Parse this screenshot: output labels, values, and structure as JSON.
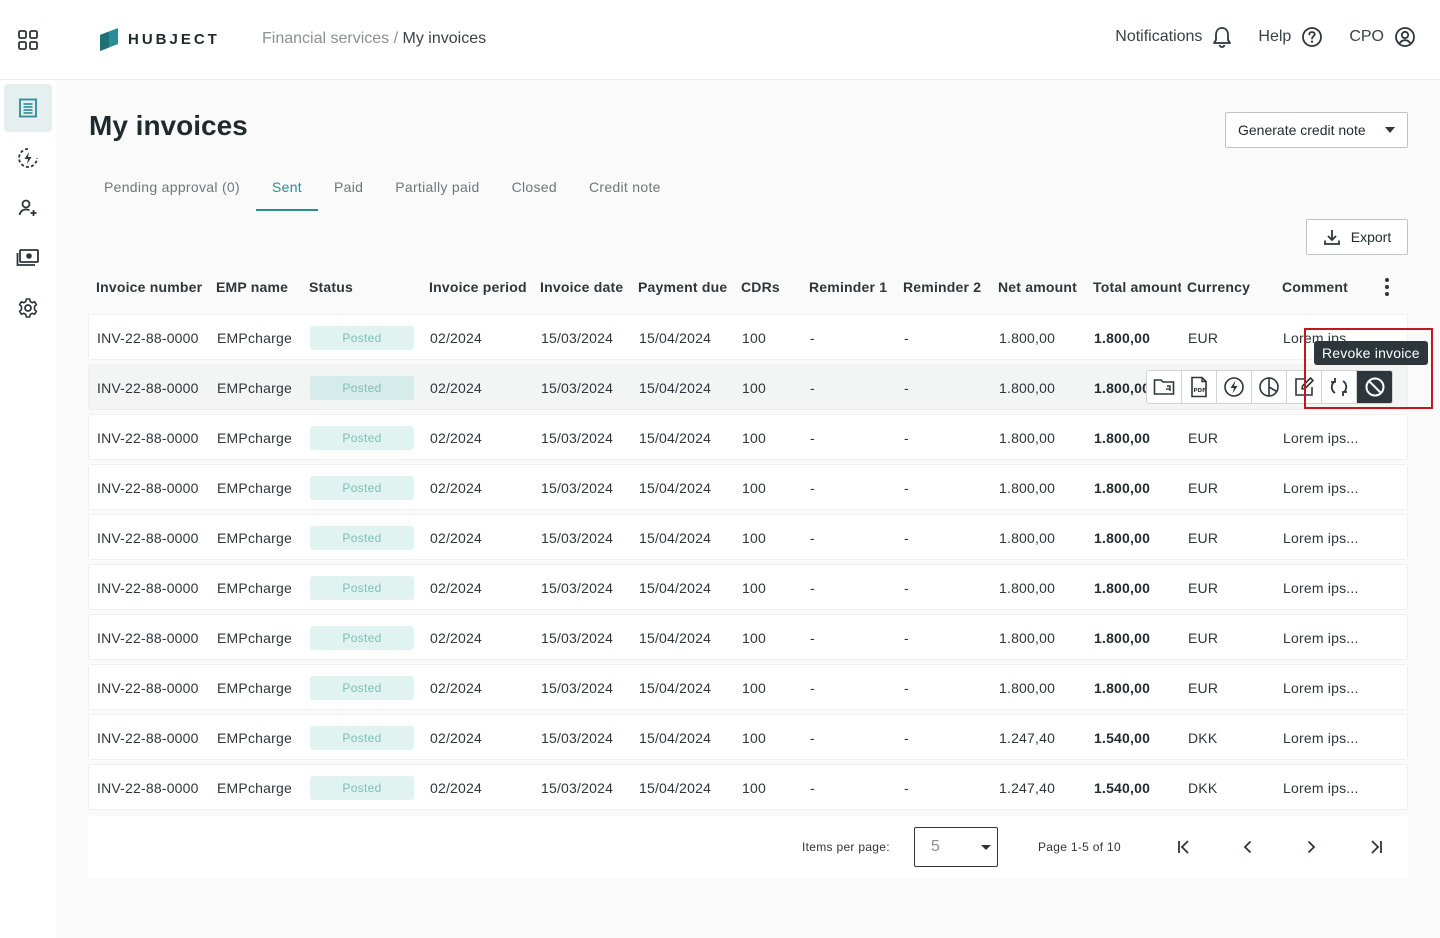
{
  "header": {
    "brand": "HUBJECT",
    "breadcrumb_parent": "Financial services",
    "breadcrumb_sep": "/",
    "breadcrumb_current": "My invoices",
    "notifications_label": "Notifications",
    "help_label": "Help",
    "user_label": "CPO"
  },
  "sidebar": {
    "items": [
      {
        "icon": "invoice-list-icon",
        "active": true
      },
      {
        "icon": "charging-icon",
        "active": false
      },
      {
        "icon": "user-add-icon",
        "active": false
      },
      {
        "icon": "money-icon",
        "active": false
      },
      {
        "icon": "gear-icon",
        "active": false
      }
    ]
  },
  "main": {
    "title": "My invoices",
    "generate_btn": "Generate credit note",
    "export_btn": "Export",
    "tabs": [
      {
        "label": "Pending approval (0)",
        "active": false
      },
      {
        "label": "Sent",
        "active": true
      },
      {
        "label": "Paid",
        "active": false
      },
      {
        "label": "Partially paid",
        "active": false
      },
      {
        "label": "Closed",
        "active": false
      },
      {
        "label": "Credit note",
        "active": false
      }
    ]
  },
  "table": {
    "columns": [
      "Invoice number",
      "EMP name",
      "Status",
      "Invoice period",
      "Invoice date",
      "Payment due",
      "CDRs",
      "Reminder 1",
      "Reminder 2",
      "Net amount",
      "Total amount",
      "Currency",
      "Comment"
    ],
    "rows": [
      {
        "inv": "INV-22-88-0000",
        "emp": "EMPcharge",
        "status": "Posted",
        "period": "02/2024",
        "date": "15/03/2024",
        "due": "15/04/2024",
        "cdrs": "100",
        "r1": "-",
        "r2": "-",
        "net": "1.800,00",
        "total": "1.800,00",
        "cur": "EUR",
        "comment": "Lorem ips..."
      },
      {
        "inv": "INV-22-88-0000",
        "emp": "EMPcharge",
        "status": "Posted",
        "period": "02/2024",
        "date": "15/03/2024",
        "due": "15/04/2024",
        "cdrs": "100",
        "r1": "-",
        "r2": "-",
        "net": "1.800,00",
        "total": "1.800,00",
        "cur": "",
        "comment": ""
      },
      {
        "inv": "INV-22-88-0000",
        "emp": "EMPcharge",
        "status": "Posted",
        "period": "02/2024",
        "date": "15/03/2024",
        "due": "15/04/2024",
        "cdrs": "100",
        "r1": "-",
        "r2": "-",
        "net": "1.800,00",
        "total": "1.800,00",
        "cur": "EUR",
        "comment": "Lorem ips..."
      },
      {
        "inv": "INV-22-88-0000",
        "emp": "EMPcharge",
        "status": "Posted",
        "period": "02/2024",
        "date": "15/03/2024",
        "due": "15/04/2024",
        "cdrs": "100",
        "r1": "-",
        "r2": "-",
        "net": "1.800,00",
        "total": "1.800,00",
        "cur": "EUR",
        "comment": "Lorem ips..."
      },
      {
        "inv": "INV-22-88-0000",
        "emp": "EMPcharge",
        "status": "Posted",
        "period": "02/2024",
        "date": "15/03/2024",
        "due": "15/04/2024",
        "cdrs": "100",
        "r1": "-",
        "r2": "-",
        "net": "1.800,00",
        "total": "1.800,00",
        "cur": "EUR",
        "comment": "Lorem ips..."
      },
      {
        "inv": "INV-22-88-0000",
        "emp": "EMPcharge",
        "status": "Posted",
        "period": "02/2024",
        "date": "15/03/2024",
        "due": "15/04/2024",
        "cdrs": "100",
        "r1": "-",
        "r2": "-",
        "net": "1.800,00",
        "total": "1.800,00",
        "cur": "EUR",
        "comment": "Lorem ips..."
      },
      {
        "inv": "INV-22-88-0000",
        "emp": "EMPcharge",
        "status": "Posted",
        "period": "02/2024",
        "date": "15/03/2024",
        "due": "15/04/2024",
        "cdrs": "100",
        "r1": "-",
        "r2": "-",
        "net": "1.800,00",
        "total": "1.800,00",
        "cur": "EUR",
        "comment": "Lorem ips..."
      },
      {
        "inv": "INV-22-88-0000",
        "emp": "EMPcharge",
        "status": "Posted",
        "period": "02/2024",
        "date": "15/03/2024",
        "due": "15/04/2024",
        "cdrs": "100",
        "r1": "-",
        "r2": "-",
        "net": "1.800,00",
        "total": "1.800,00",
        "cur": "EUR",
        "comment": "Lorem ips..."
      },
      {
        "inv": "INV-22-88-0000",
        "emp": "EMPcharge",
        "status": "Posted",
        "period": "02/2024",
        "date": "15/03/2024",
        "due": "15/04/2024",
        "cdrs": "100",
        "r1": "-",
        "r2": "-",
        "net": "1.247,40",
        "total": "1.540,00",
        "cur": "DKK",
        "comment": "Lorem ips..."
      },
      {
        "inv": "INV-22-88-0000",
        "emp": "EMPcharge",
        "status": "Posted",
        "period": "02/2024",
        "date": "15/03/2024",
        "due": "15/04/2024",
        "cdrs": "100",
        "r1": "-",
        "r2": "-",
        "net": "1.247,40",
        "total": "1.540,00",
        "cur": "DKK",
        "comment": "Lorem ips..."
      }
    ],
    "row_actions": {
      "icons": [
        "folder-icon",
        "pdf-icon",
        "charging-icon",
        "pie-chart-icon",
        "edit-icon",
        "replace-icon",
        "revoke-icon"
      ],
      "tooltip": "Revoke invoice"
    }
  },
  "pagination": {
    "items_per_page_label": "Items per page:",
    "items_per_page_value": "5",
    "page_info": "Page 1-5 of 10"
  }
}
